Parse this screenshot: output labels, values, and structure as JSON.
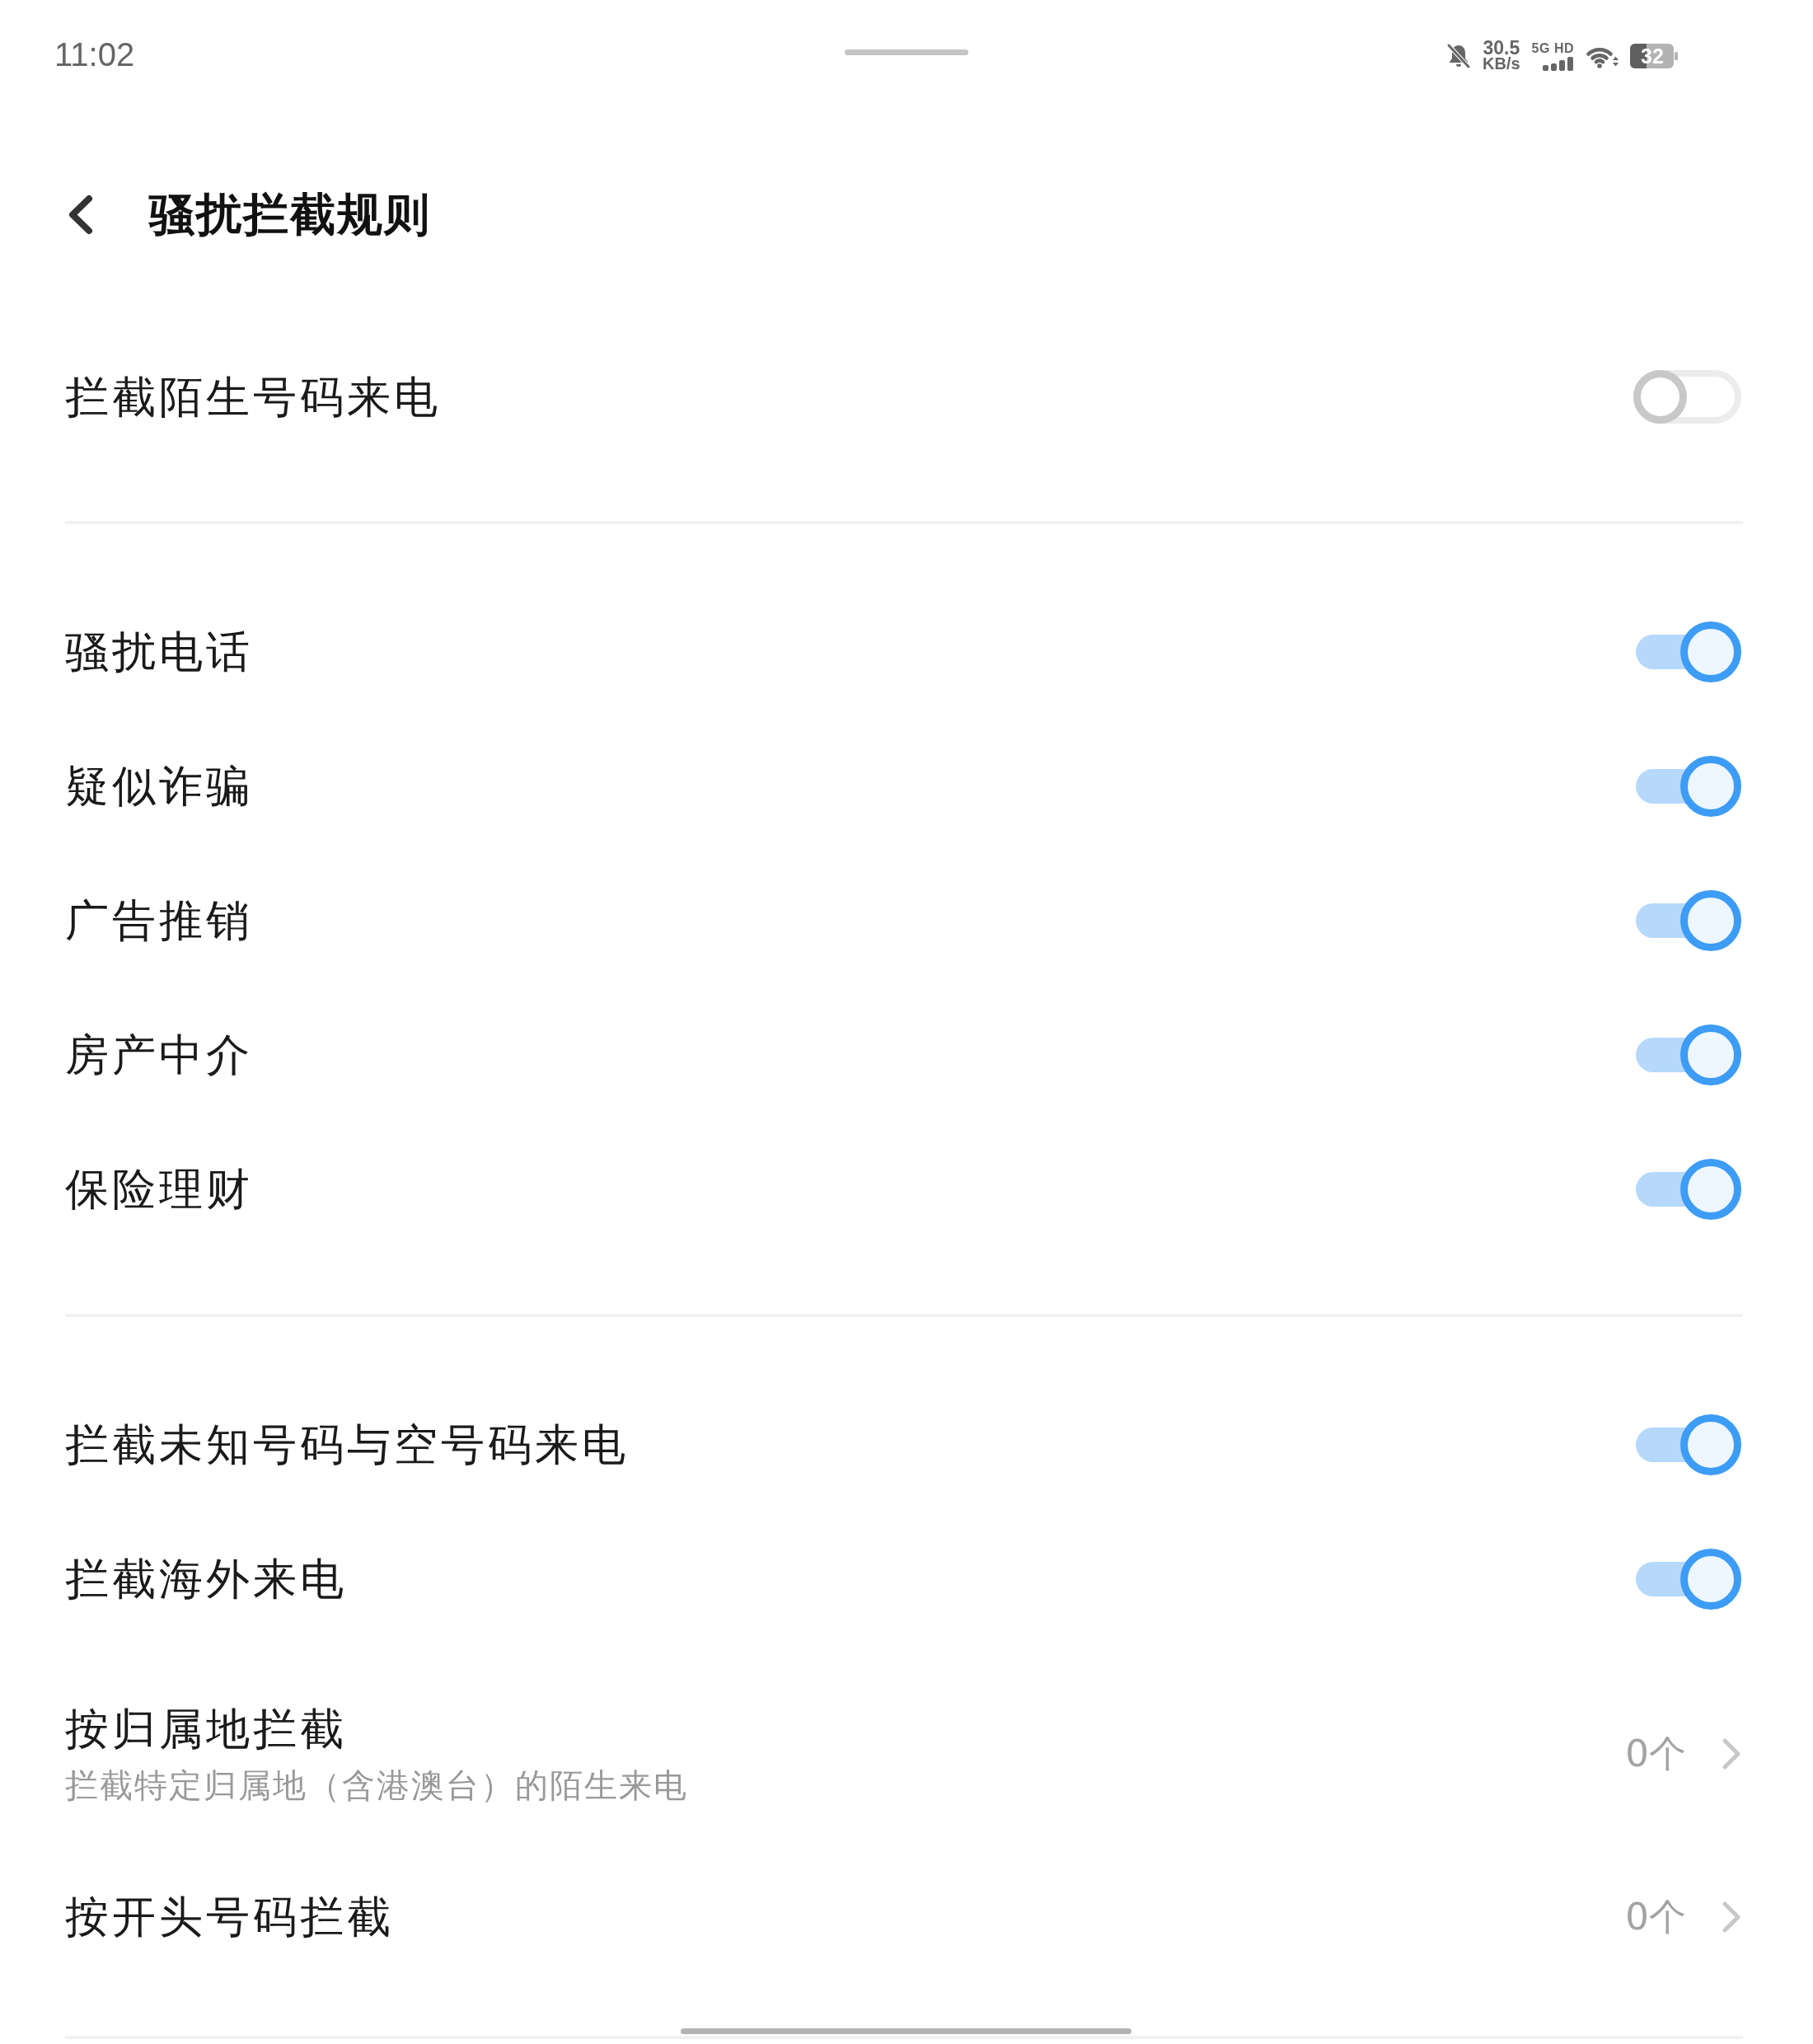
{
  "status_bar": {
    "time": "11:02",
    "speed": "30.5",
    "speed_unit": "KB/s",
    "network": "5G HD",
    "battery": "32"
  },
  "header": {
    "title": "骚扰拦截规则"
  },
  "sections": [
    {
      "items": [
        {
          "kind": "toggle",
          "label": "拦截陌生号码来电",
          "on": false
        }
      ]
    },
    {
      "items": [
        {
          "kind": "toggle",
          "label": "骚扰电话",
          "on": true
        },
        {
          "kind": "toggle",
          "label": "疑似诈骗",
          "on": true
        },
        {
          "kind": "toggle",
          "label": "广告推销",
          "on": true
        },
        {
          "kind": "toggle",
          "label": "房产中介",
          "on": true
        },
        {
          "kind": "toggle",
          "label": "保险理财",
          "on": true
        }
      ]
    },
    {
      "items": [
        {
          "kind": "toggle",
          "label": "拦截未知号码与空号码来电",
          "on": true
        },
        {
          "kind": "toggle",
          "label": "拦截海外来电",
          "on": true
        },
        {
          "kind": "link",
          "label": "按归属地拦截",
          "subtitle": "拦截特定归属地（含港澳台）的陌生来电",
          "value": "0个"
        },
        {
          "kind": "link",
          "label": "按开头号码拦截",
          "value": "0个"
        }
      ]
    }
  ]
}
